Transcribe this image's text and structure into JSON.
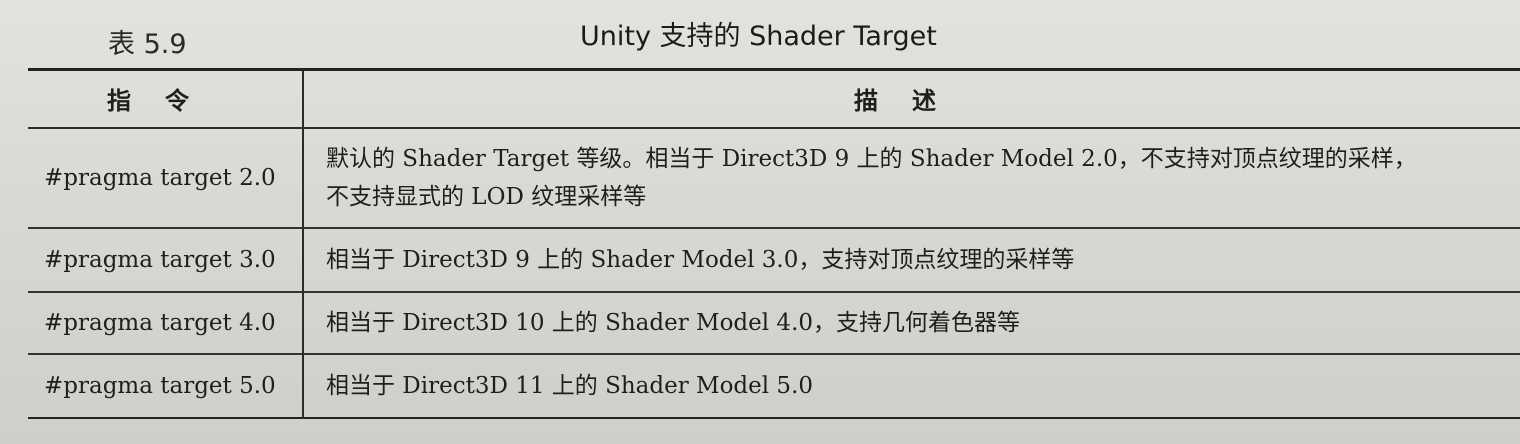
{
  "caption": {
    "number": "表 5.9",
    "title": "Unity 支持的 Shader Target"
  },
  "table": {
    "headers": [
      "指令",
      "描述"
    ],
    "rows": [
      {
        "command": "#pragma target 2.0",
        "description": [
          "默认的 Shader Target 等级。相当于 Direct3D 9 上的 Shader Model 2.0，不支持对顶点纹理的采样，",
          "不支持显式的 LOD 纹理采样等"
        ]
      },
      {
        "command": "#pragma target 3.0",
        "description": [
          "相当于 Direct3D 9 上的 Shader Model 3.0，支持对顶点纹理的采样等"
        ]
      },
      {
        "command": "#pragma target 4.0",
        "description": [
          "相当于 Direct3D 10 上的 Shader Model 4.0，支持几何着色器等"
        ]
      },
      {
        "command": "#pragma target 5.0",
        "description": [
          "相当于 Direct3D 11 上的 Shader Model 5.0"
        ]
      }
    ]
  }
}
